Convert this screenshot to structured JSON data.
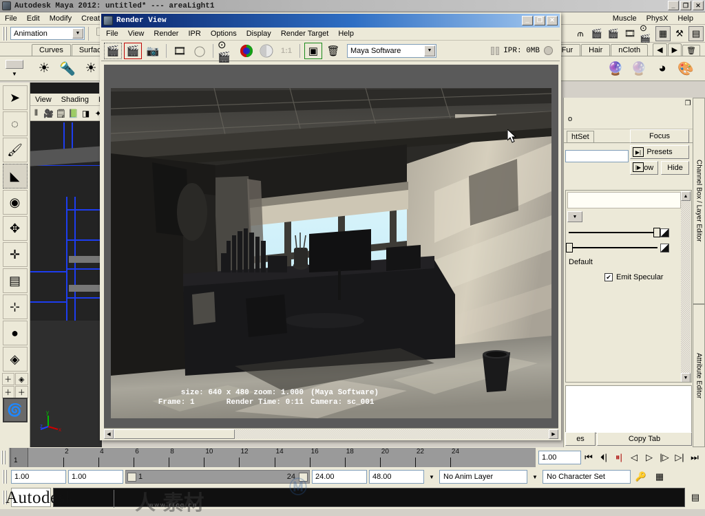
{
  "app": {
    "title": "Autodesk Maya 2012:  untitled*     ---     areaLight1",
    "icon": "maya-icon",
    "window_buttons": {
      "minimize": "_",
      "maximize": "❐",
      "close": "✕"
    }
  },
  "main_menu": {
    "left_items": [
      "File",
      "Edit",
      "Modify",
      "Create"
    ],
    "right_items": [
      "Muscle",
      "PhysX",
      "Help"
    ]
  },
  "status_line": {
    "menu_set": "Animation",
    "icons": [
      "new-scene-icon",
      "open-scene-icon",
      "save-scene-icon",
      "undo-icon",
      "redo-icon",
      "select-by-hierarchy-icon",
      "select-by-object-icon",
      "select-by-component-icon",
      "snap-grid-icon",
      "snap-curve-icon",
      "snap-point-icon",
      "snap-view-icon",
      "construction-history-icon",
      "render-icon",
      "ipr-render-icon",
      "render-settings-icon"
    ]
  },
  "shelf": {
    "tabs_left": [
      "Curves",
      "Surfaces"
    ],
    "tabs_right": [
      "Fur",
      "Hair",
      "nCloth"
    ],
    "trash": "trash-icon",
    "nav_prev": "◀",
    "nav_next": "▶"
  },
  "toolbox": {
    "items": [
      {
        "name": "select-tool",
        "glyph": "➤"
      },
      {
        "name": "lasso-select-tool",
        "glyph": "◌"
      },
      {
        "name": "paint-select-tool",
        "glyph": "🖌"
      },
      {
        "name": "move-tool",
        "glyph": "◣"
      },
      {
        "name": "rotate-tool",
        "glyph": "◉"
      },
      {
        "name": "scale-tool",
        "glyph": "✥"
      },
      {
        "name": "universal-manipulator-tool",
        "glyph": "✛"
      },
      {
        "name": "soft-modification-tool",
        "glyph": "▤"
      },
      {
        "name": "show-manipulator-tool",
        "glyph": "⊹"
      },
      {
        "name": "last-tool-used",
        "glyph": "●"
      },
      {
        "name": "four-view-layout",
        "glyph": "◈"
      }
    ],
    "quad_layout": [
      "＋",
      "◈",
      "＋",
      "＋"
    ],
    "bottom_icon": "maya-swirl-icon"
  },
  "viewport": {
    "menus": [
      "View",
      "Shading",
      "Lig"
    ],
    "axis_labels": {
      "x": "x",
      "y": "y",
      "z": "z"
    }
  },
  "render_view": {
    "title": "Render View",
    "icon": "maya-icon",
    "window_buttons": {
      "minimize": "_",
      "maximize": "❐",
      "close": "✕"
    },
    "menus": [
      "File",
      "View",
      "Render",
      "IPR",
      "Options",
      "Display",
      "Render Target",
      "Help"
    ],
    "toolbar_icons": [
      {
        "name": "render-current-frame-icon",
        "glyph": "🎬"
      },
      {
        "name": "redo-previous-render-icon",
        "glyph": "🎬"
      },
      {
        "name": "snapshot-icon",
        "glyph": "📷"
      },
      {
        "name": "ipr-render-icon",
        "glyph": "🎞"
      },
      {
        "name": "refresh-ipr-icon",
        "glyph": "◯"
      },
      {
        "name": "render-region-icon",
        "glyph": "⊙"
      },
      {
        "name": "rgb-channel-icon",
        "glyph": "◓"
      },
      {
        "name": "alpha-channel-icon",
        "glyph": "◐"
      },
      {
        "name": "one-to-one-ratio-icon",
        "glyph": "1:1"
      },
      {
        "name": "keep-image-icon",
        "glyph": "▣"
      },
      {
        "name": "remove-image-icon",
        "glyph": "🗑"
      }
    ],
    "renderer": "Maya Software",
    "ipr_label": "IPR: 0MB",
    "status": {
      "size": "size:  640 x 480  zoom: 1.000",
      "renderer": "(Maya Software)",
      "frame": "Frame: 1",
      "render_time": "Render Time: 0:11",
      "camera": "Camera: sc_001"
    },
    "scrollbar": {
      "left": "◀",
      "right": "▶"
    }
  },
  "right_panel": {
    "header_icons": [
      "undock-icon",
      "close-icon"
    ],
    "vertical_tabs": [
      "Channel Box / Layer Editor",
      "Attribute Editor"
    ],
    "node_name_fragment": "htSet",
    "buttons": {
      "focus": "Focus",
      "presets": "Presets",
      "show": "Show",
      "hide": "Hide"
    },
    "label_default": "Default",
    "checkbox_emit_specular": {
      "label": "Emit Specular",
      "checked": true
    },
    "copy_tab": "Copy Tab",
    "notes_fragment": "es"
  },
  "time_slider": {
    "current_frame": "1",
    "ticks": [
      "2",
      "4",
      "6",
      "8",
      "10",
      "12",
      "14",
      "16",
      "18",
      "20",
      "22",
      "24"
    ],
    "current_time_field": "1.00",
    "playback_icons": [
      "go-to-start-icon",
      "step-back-keyframe-icon",
      "step-back-frame-icon",
      "play-backwards-icon",
      "play-forwards-icon",
      "step-forward-frame-icon",
      "step-forward-keyframe-icon",
      "go-to-end-icon"
    ]
  },
  "range_slider": {
    "anim_start": "1.00",
    "range_start": "1.00",
    "range_bar_start": "1",
    "range_bar_end": "24",
    "range_end": "24.00",
    "anim_end": "48.00",
    "anim_layer": "No Anim Layer",
    "character_set": "No Character Set",
    "auto_key_icon": "key-icon",
    "anim_prefs_icon": "animation-preferences-icon"
  },
  "command_line": {
    "output_icon": "script-editor-icon"
  },
  "branding": {
    "autodesk": "Autodesk",
    "watermark_cn": "人 素材",
    "watermark_url": "www.rrcg.cn"
  },
  "colors": {
    "window_chrome": "#ece9d8",
    "title_active": "#0a246a",
    "render_bg": "#5a5a5a",
    "wireframe_blue": "#1d3df0",
    "accent_green": "#1a8a1a",
    "accent_red": "#c00000"
  }
}
